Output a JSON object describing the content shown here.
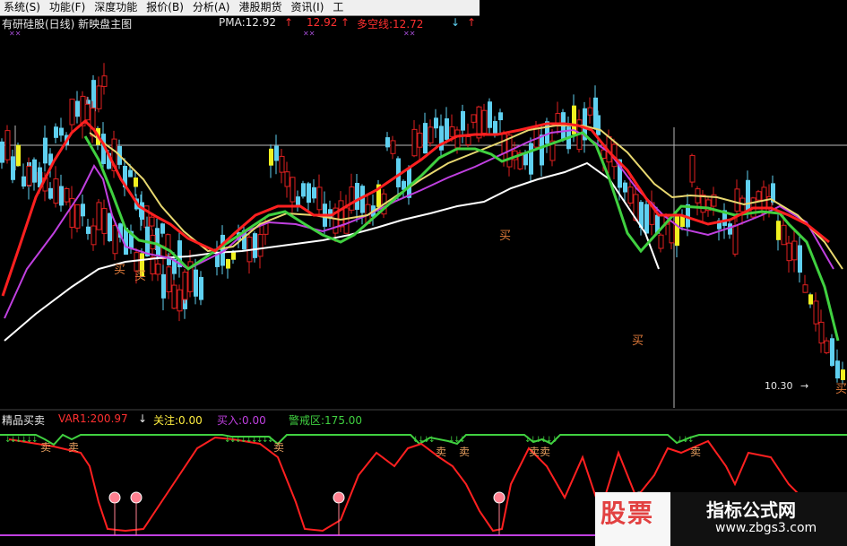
{
  "menubar": {
    "items": [
      "系统(S)",
      "功能(F)",
      "深度功能",
      "报价(B)",
      "分析(A)",
      "港股期货",
      "资讯(I)",
      "工"
    ]
  },
  "chart_header": {
    "title": "有研硅股(日线) 新映盘主图",
    "pma": "PMA:12.92",
    "pma_arrow": "↑",
    "value2": "12.92",
    "value2_arrow": "↑",
    "multi_line": "多空线:12.72",
    "multi_line_arrow": "↓",
    "tail": "↑"
  },
  "main_chart": {
    "buy_label": "买",
    "price_marker": "10.30",
    "price_arrow": "→"
  },
  "indicator": {
    "name": "精品买卖",
    "var1": "VAR1:200.97",
    "var1_arrow": "↓",
    "guanzhu": "关注:0.00",
    "mairu": "买入:0.00",
    "jingjie": "警戒区:175.00",
    "sell_label": "卖"
  },
  "watermark": {
    "left_text": "股票",
    "right_title": "指标公式网",
    "right_url": "www.zbgs3.com"
  },
  "colors": {
    "up": "#e02020",
    "down": "#5fd0f0",
    "ma_red": "#ff2020",
    "ma_green": "#40d040",
    "ma_yellow": "#e8d870",
    "ma_purple": "#c040e0",
    "ma_white": "#ffffff",
    "guide": "#bbbbbb"
  }
}
